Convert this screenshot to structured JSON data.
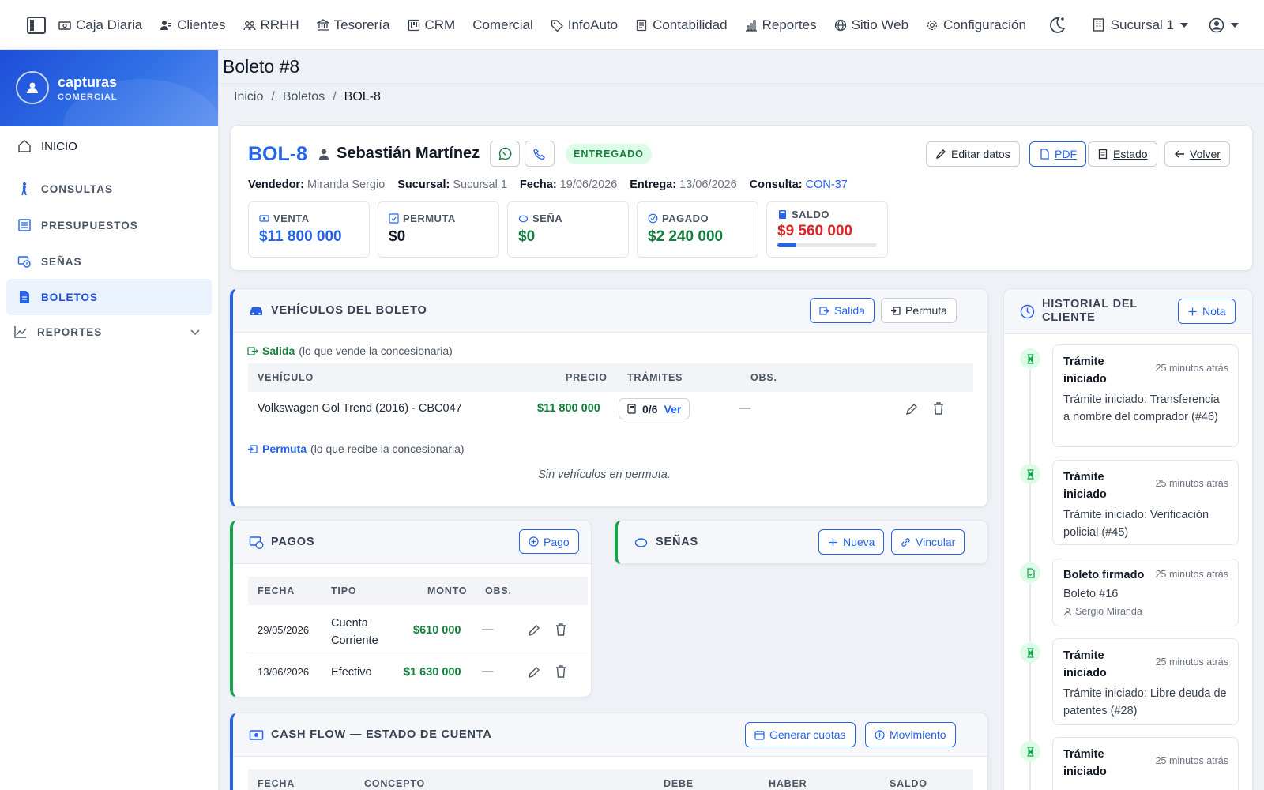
{
  "topnav": {
    "items": [
      {
        "label": "Caja Diaria",
        "icon": "cash-register-icon"
      },
      {
        "label": "Clientes",
        "icon": "users-icon"
      },
      {
        "label": "RRHH",
        "icon": "people-icon"
      },
      {
        "label": "Tesorería",
        "icon": "bank-icon"
      },
      {
        "label": "CRM",
        "icon": "kanban-icon"
      },
      {
        "label": "Comercial",
        "icon": ""
      },
      {
        "label": "InfoAuto",
        "icon": "tag-icon"
      },
      {
        "label": "Contabilidad",
        "icon": "ledger-icon"
      },
      {
        "label": "Reportes",
        "icon": "bar-chart-icon"
      },
      {
        "label": "Sitio Web",
        "icon": "globe-icon"
      },
      {
        "label": "Configuración",
        "icon": "gear-icon"
      }
    ],
    "branch": "Sucursal 1"
  },
  "sidebar": {
    "brand_name": "capturas",
    "brand_sub": "COMERCIAL",
    "items": [
      {
        "label": "INICIO",
        "icon": "home-icon"
      },
      {
        "label": "CONSULTAS",
        "icon": "person-walking-icon"
      },
      {
        "label": "PRESUPUESTOS",
        "icon": "list-icon"
      },
      {
        "label": "SEÑAS",
        "icon": "cash-icon"
      },
      {
        "label": "BOLETOS",
        "icon": "file-icon"
      },
      {
        "label": "REPORTES",
        "icon": "line-chart-icon"
      }
    ]
  },
  "page": {
    "title": "Boleto #8",
    "breadcrumb": [
      "Inicio",
      "Boletos",
      "BOL-8"
    ]
  },
  "boleto": {
    "code": "BOL-8",
    "client": "Sebastián Martínez",
    "status": "ENTREGADO",
    "actions": {
      "edit": "Editar datos",
      "pdf": "PDF",
      "estado": "Estado",
      "volver": "Volver"
    },
    "meta": {
      "vendedor_label": "Vendedor:",
      "vendedor": "Miranda Sergio",
      "sucursal_label": "Sucursal:",
      "sucursal": "Sucursal 1",
      "fecha_label": "Fecha:",
      "fecha": "19/06/2026",
      "entrega_label": "Entrega:",
      "entrega": "13/06/2026",
      "consulta_label": "Consulta:",
      "consulta": "CON-37"
    },
    "stats": [
      {
        "label": "VENTA",
        "value": "$11 800 000",
        "color": "#2563eb"
      },
      {
        "label": "PERMUTA",
        "value": "$0",
        "color": "#111827"
      },
      {
        "label": "SEÑA",
        "value": "$0",
        "color": "#15803d"
      },
      {
        "label": "PAGADO",
        "value": "$2 240 000",
        "color": "#15803d"
      },
      {
        "label": "SALDO",
        "value": "$9 560 000",
        "color": "#dc2626",
        "progress": 0.19
      }
    ]
  },
  "vehiculos": {
    "title": "VEHÍCULOS DEL BOLETO",
    "btn_salida": "Salida",
    "btn_permuta": "Permuta",
    "salida_label": "Salida",
    "salida_desc": "(lo que vende la concesionaria)",
    "columns": [
      "VEHÍCULO",
      "PRECIO",
      "TRÁMITES",
      "OBS."
    ],
    "rows": [
      {
        "vehiculo": "Volkswagen Gol Trend (2016) - CBC047",
        "precio": "$11 800 000",
        "tramites": "0/6",
        "ver": "Ver",
        "obs": "—"
      }
    ],
    "permuta_label": "Permuta",
    "permuta_desc": "(lo que recibe la concesionaria)",
    "permuta_empty": "Sin vehículos en permuta."
  },
  "pagos": {
    "title": "PAGOS",
    "btn": "Pago",
    "columns": [
      "FECHA",
      "TIPO",
      "MONTO",
      "OBS."
    ],
    "rows": [
      {
        "fecha": "29/05/2026",
        "tipo": "Cuenta Corriente",
        "monto": "$610 000",
        "obs": "—"
      },
      {
        "fecha": "13/06/2026",
        "tipo": "Efectivo",
        "monto": "$1 630 000",
        "obs": "—"
      }
    ]
  },
  "senas": {
    "title": "SEÑAS",
    "btn_nueva": "Nueva",
    "btn_vincular": "Vincular"
  },
  "cashflow": {
    "title": "CASH FLOW — ESTADO DE CUENTA",
    "btn_cuotas": "Generar cuotas",
    "btn_mov": "Movimiento",
    "columns": [
      "FECHA",
      "CONCEPTO",
      "DEBE",
      "HABER",
      "SALDO"
    ]
  },
  "historial": {
    "title": "HISTORIAL DEL CLIENTE",
    "btn": "Nota",
    "items": [
      {
        "title": "Trámite iniciado",
        "time": "25 minutos atrás",
        "body": "Trámite iniciado: Transferencia a nombre del comprador (#46)",
        "user": ""
      },
      {
        "title": "Trámite iniciado",
        "time": "25 minutos atrás",
        "body": "Trámite iniciado: Verificación policial (#45)",
        "user": ""
      },
      {
        "title": "Boleto firmado",
        "time": "25 minutos atrás",
        "body": "Boleto #16",
        "user": "Sergio Miranda"
      },
      {
        "title": "Trámite iniciado",
        "time": "25 minutos atrás",
        "body": "Trámite iniciado: Libre deuda de patentes (#28)",
        "user": ""
      },
      {
        "title": "Trámite iniciado",
        "time": "25 minutos atrás",
        "body": "",
        "user": ""
      }
    ]
  }
}
